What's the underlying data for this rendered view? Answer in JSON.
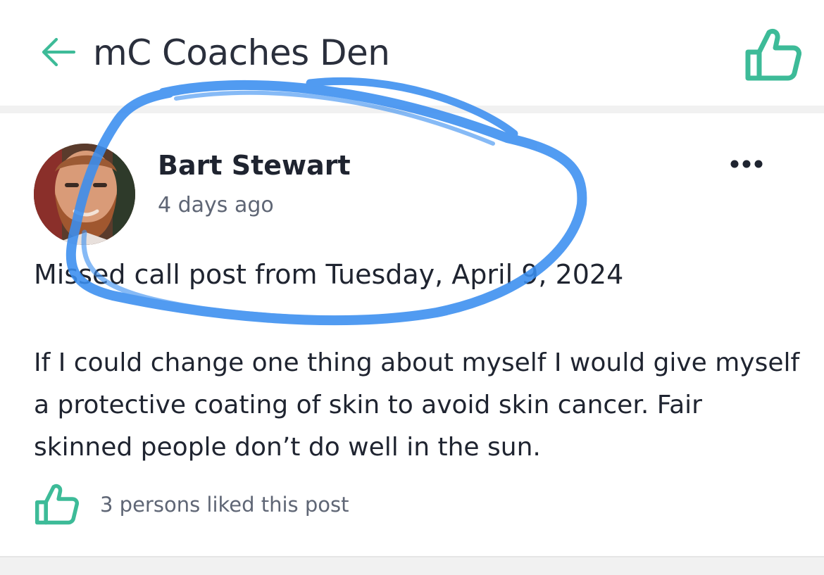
{
  "header": {
    "title": "mC Coaches Den",
    "back_icon": "arrow-left-icon",
    "like_icon": "thumbs-up-icon"
  },
  "post": {
    "author": "Bart Stewart",
    "time_ago": "4 days ago",
    "more_icon": "more-horizontal-icon",
    "subject": "Missed call post from Tuesday, April 9, 2024",
    "body": "If I could change one thing about myself I would give myself a protective coating of skin to avoid skin cancer. Fair skinned people don’t do well in the sun.",
    "like_icon": "thumbs-up-icon",
    "likes_text": "3 persons liked this post"
  },
  "colors": {
    "accent": "#3dbb98",
    "annotation": "#3a8ef0",
    "text": "#1f2430",
    "muted": "#5f6675"
  }
}
